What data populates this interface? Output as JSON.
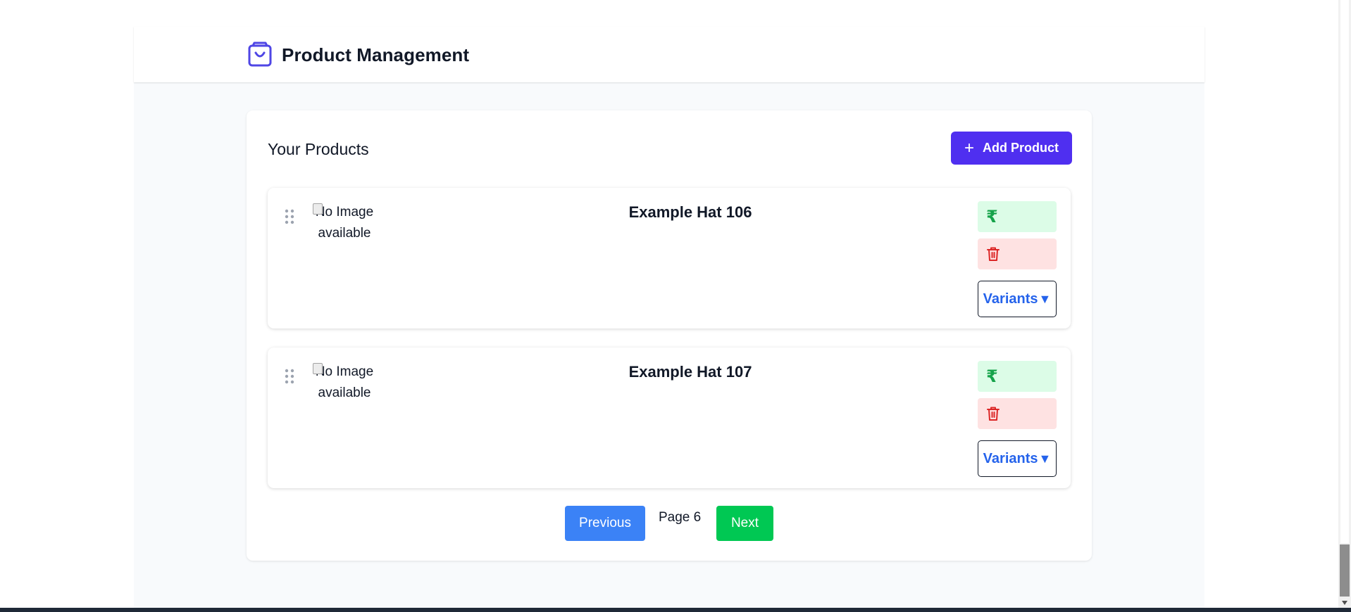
{
  "header": {
    "title": "Product Management",
    "icon": "shopping-bag-icon",
    "accent_color": "#4f46e5"
  },
  "panel": {
    "title": "Your Products",
    "add_button": {
      "label": "Add Product",
      "icon": "plus-icon",
      "color": "#4f2ff0"
    }
  },
  "products": [
    {
      "title": "Example Hat 106",
      "image_alt": "No Image available",
      "price_symbol": "₹",
      "variants_label": "Variants",
      "variants_caret": "▼"
    },
    {
      "title": "Example Hat 107",
      "image_alt": "No Image available",
      "price_symbol": "₹",
      "variants_label": "Variants",
      "variants_caret": "▼"
    }
  ],
  "pagination": {
    "previous_label": "Previous",
    "page_label": "Page 6",
    "next_label": "Next",
    "previous_color": "#3b82f6",
    "next_color": "#00c853"
  }
}
